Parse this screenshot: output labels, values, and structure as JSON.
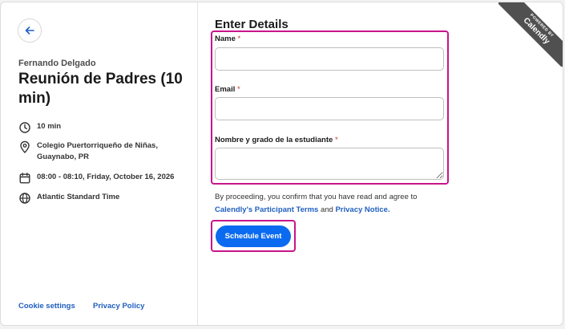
{
  "sidebar": {
    "organizer": "Fernando Delgado",
    "event_title": "Reunión de Padres (10 min)",
    "duration": "10 min",
    "location": "Colegio Puertorriqueño de Niñas, Guaynabo, PR",
    "datetime": "08:00 - 08:10, Friday, October 16, 2026",
    "timezone": "Atlantic Standard Time",
    "cookie_settings": "Cookie settings",
    "privacy_policy": "Privacy Policy"
  },
  "form": {
    "heading": "Enter Details",
    "name_label": "Name",
    "email_label": "Email",
    "student_label": "Nombre y grado de la estudiante",
    "required_mark": "*",
    "name_value": "",
    "email_value": "",
    "student_value": "",
    "terms_prefix": "By proceeding, you confirm that you have read and agree to",
    "terms_link": "Calendly's Participant Terms",
    "terms_and": "and",
    "privacy_link": "Privacy Notice.",
    "submit_label": "Schedule Event"
  },
  "badge": {
    "small": "POWERED BY",
    "brand": "Calendly"
  },
  "colors": {
    "accent": "#0b6bf0",
    "highlight": "#c7158a",
    "link": "#1f5fbf",
    "ribbon": "#505050"
  },
  "icons": {
    "back": "arrow-left-icon",
    "duration": "clock-icon",
    "location": "map-pin-icon",
    "datetime": "calendar-icon",
    "timezone": "globe-icon"
  }
}
